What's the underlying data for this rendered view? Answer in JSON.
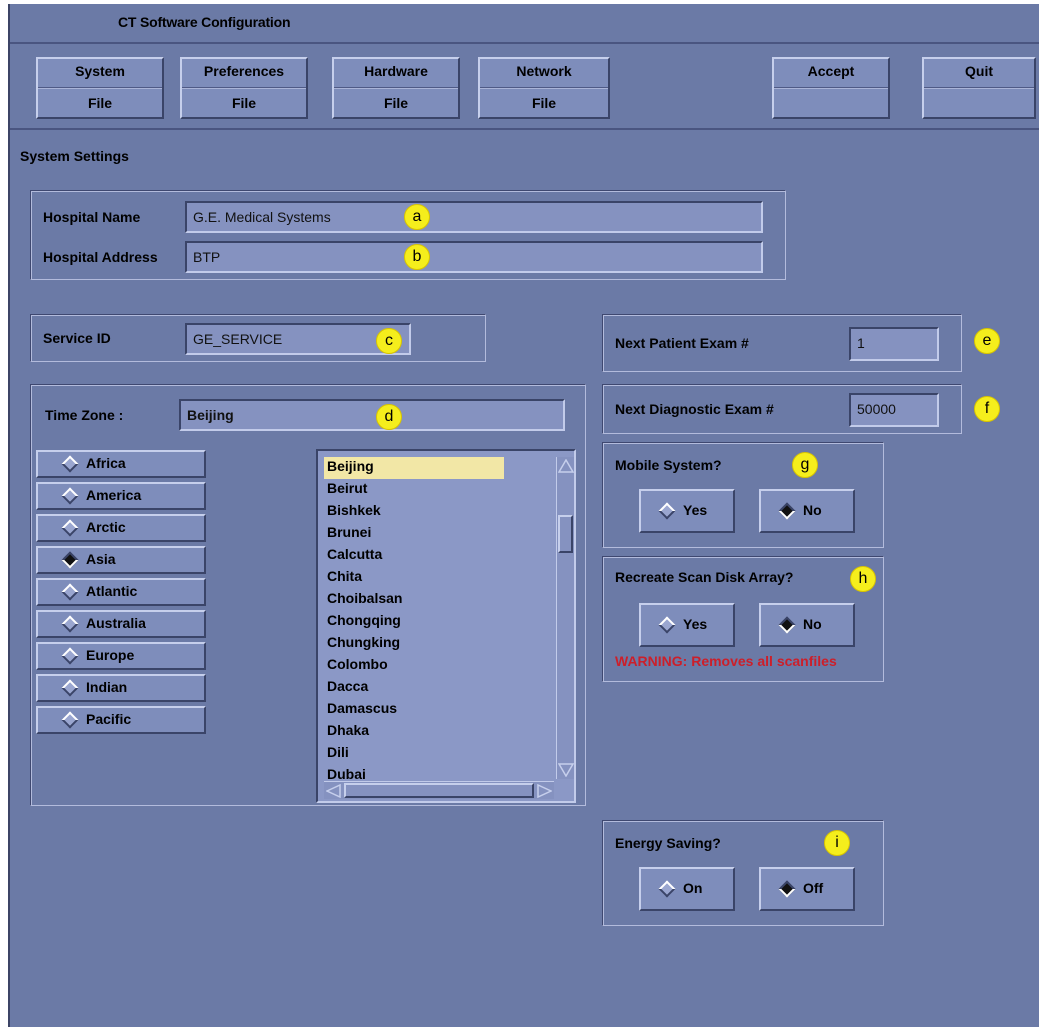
{
  "window": {
    "title": "CT Software Configuration"
  },
  "toolbar": {
    "system": {
      "top": "System",
      "bottom": "File"
    },
    "preferences": {
      "top": "Preferences",
      "bottom": "File"
    },
    "hardware": {
      "top": "Hardware",
      "bottom": "File"
    },
    "network": {
      "top": "Network",
      "bottom": "File"
    },
    "accept": {
      "top": "Accept",
      "bottom": ""
    },
    "quit": {
      "top": "Quit",
      "bottom": ""
    }
  },
  "section_title": "System Settings",
  "hospital": {
    "name_label": "Hospital Name",
    "name_value": "G.E. Medical Systems",
    "address_label": "Hospital Address",
    "address_value": "BTP"
  },
  "service": {
    "label": "Service ID",
    "value": "GE_SERVICE"
  },
  "timezone": {
    "label": "Time Zone :",
    "value": "Beijing",
    "regions": [
      {
        "label": "Africa",
        "selected": false
      },
      {
        "label": "America",
        "selected": false
      },
      {
        "label": "Arctic",
        "selected": false
      },
      {
        "label": "Asia",
        "selected": true
      },
      {
        "label": "Atlantic",
        "selected": false
      },
      {
        "label": "Australia",
        "selected": false
      },
      {
        "label": "Europe",
        "selected": false
      },
      {
        "label": "Indian",
        "selected": false
      },
      {
        "label": "Pacific",
        "selected": false
      }
    ],
    "cities": [
      "Beijing",
      "Beirut",
      "Bishkek",
      "Brunei",
      "Calcutta",
      "Chita",
      "Choibalsan",
      "Chongqing",
      "Chungking",
      "Colombo",
      "Dacca",
      "Damascus",
      "Dhaka",
      "Dili",
      "Dubai"
    ],
    "selected_city": "Beijing"
  },
  "next_patient": {
    "label": "Next Patient Exam #",
    "value": "1"
  },
  "next_diagnostic": {
    "label": "Next Diagnostic Exam #",
    "value": "50000"
  },
  "mobile": {
    "label": "Mobile System?",
    "yes": "Yes",
    "no": "No",
    "selected": "No"
  },
  "recreate": {
    "label": "Recreate Scan Disk Array?",
    "yes": "Yes",
    "no": "No",
    "selected": "No",
    "warning": "WARNING: Removes all scanfiles"
  },
  "energy": {
    "label": "Energy Saving?",
    "on": "On",
    "off": "Off",
    "selected": "Off"
  },
  "markers": {
    "a": "a",
    "b": "b",
    "c": "c",
    "d": "d",
    "e": "e",
    "f": "f",
    "g": "g",
    "h": "h",
    "i": "i"
  },
  "colors": {
    "background": "#6b7aa6",
    "marker": "#f5ee1c",
    "warning": "#cc1f2a",
    "selection": "#f2e7a6"
  }
}
